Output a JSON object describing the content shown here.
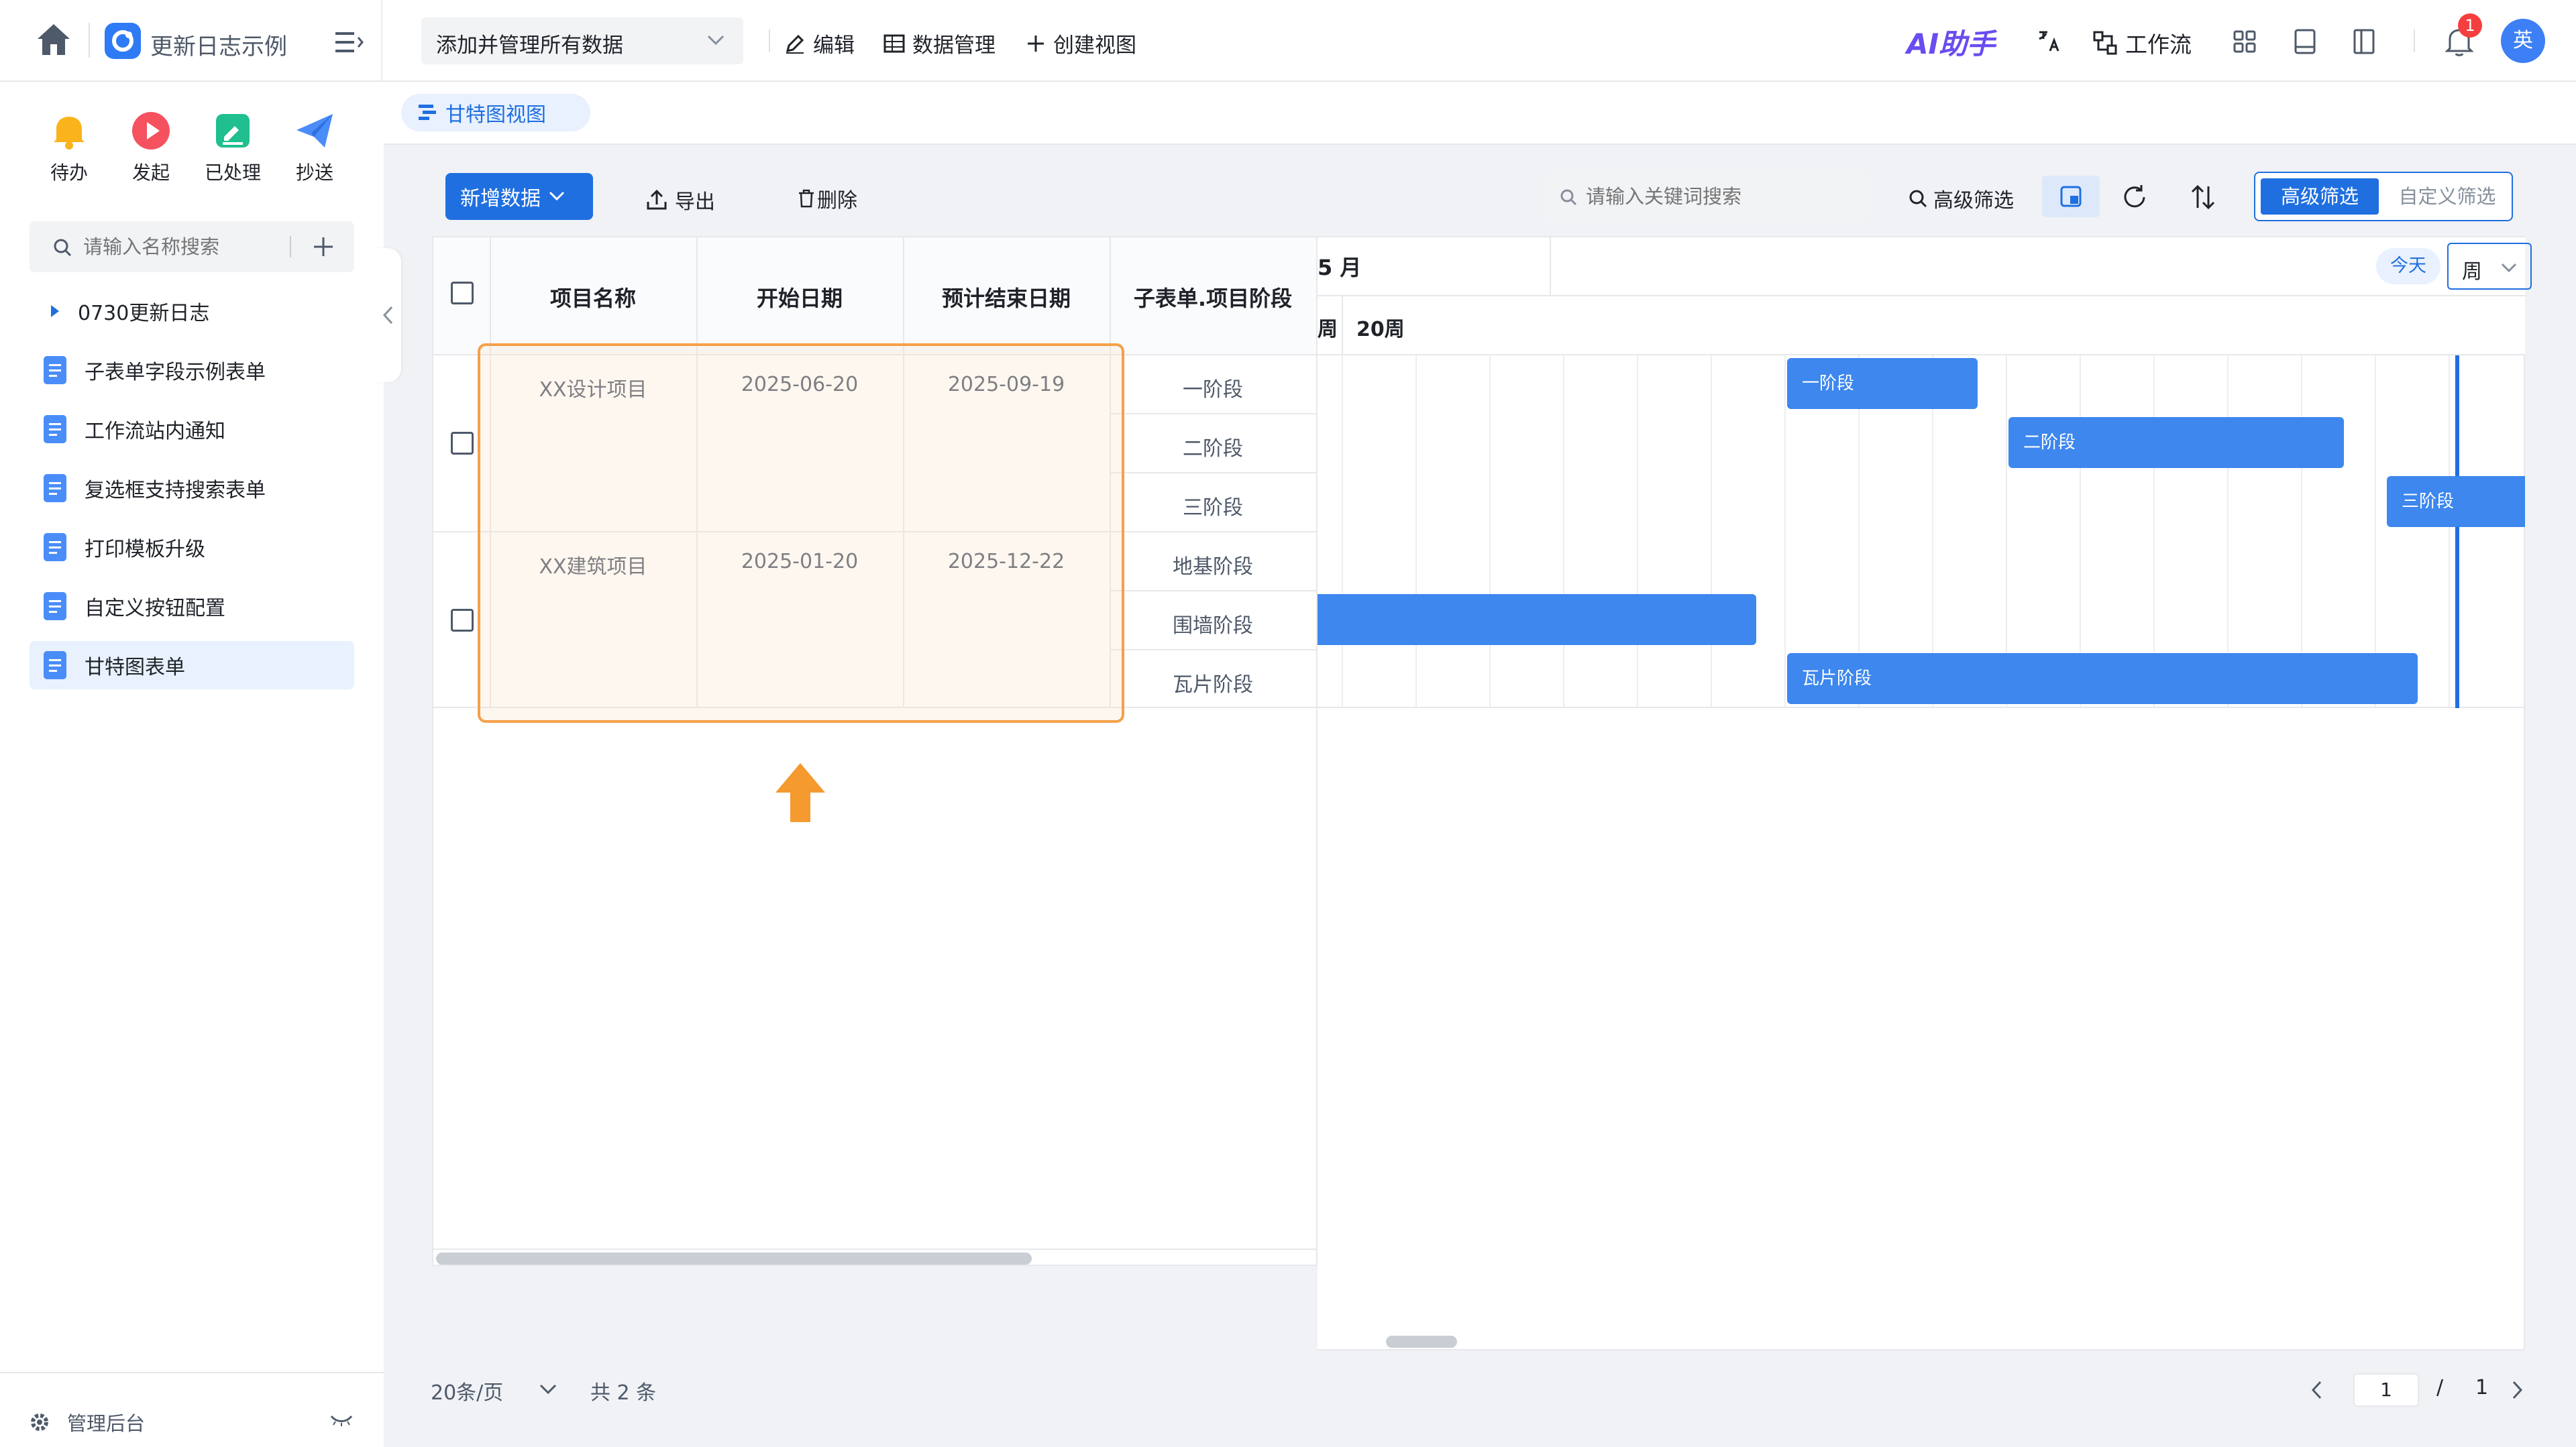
{
  "topbar": {
    "app_name": "更新日志示例",
    "view_select": "添加并管理所有数据",
    "edit": "编辑",
    "data_manage": "数据管理",
    "create_view": "创建视图",
    "ai_assistant": "AI助手",
    "workflow": "工作流",
    "notification_count": "1",
    "avatar": "英"
  },
  "quick": {
    "todo": "待办",
    "initiate": "发起",
    "processed": "已处理",
    "cc": "抄送"
  },
  "sidebar": {
    "search_placeholder": "请输入名称搜索",
    "group": "0730更新日志",
    "items": [
      {
        "label": "子表单字段示例表单"
      },
      {
        "label": "工作流站内通知"
      },
      {
        "label": "复选框支持搜索表单"
      },
      {
        "label": "打印模板升级"
      },
      {
        "label": "自定义按钮配置"
      },
      {
        "label": "甘特图表单"
      }
    ],
    "admin": "管理后台"
  },
  "tab": {
    "label": "甘特图视图"
  },
  "toolbar": {
    "new_data": "新增数据",
    "export": "导出",
    "delete": "删除",
    "search_placeholder": "请输入关键词搜索",
    "advanced_filter": "高级筛选",
    "seg_advanced": "高级筛选",
    "seg_custom": "自定义筛选"
  },
  "table": {
    "headers": [
      "项目名称",
      "开始日期",
      "预计结束日期",
      "子表单.项目阶段"
    ],
    "rows": [
      {
        "name": "XX设计项目",
        "start": "2025-06-20",
        "end": "2025-09-19",
        "stages": [
          "一阶段",
          "二阶段",
          "三阶段"
        ]
      },
      {
        "name": "XX建筑项目",
        "start": "2025-01-20",
        "end": "2025-12-22",
        "stages": [
          "地基阶段",
          "围墙阶段",
          "瓦片阶段"
        ]
      }
    ]
  },
  "gantt": {
    "month": "5 月",
    "week_prev": "周",
    "week": "20周",
    "today": "今天",
    "scale": "周",
    "bars": [
      "一阶段",
      "二阶段",
      "三阶段",
      "",
      "瓦片阶段"
    ]
  },
  "pagination": {
    "page_size": "20条/页",
    "total": "共 2 条",
    "current": "1",
    "sep": "/",
    "pages": "1"
  },
  "colors": {
    "primary": "#1f6fe0",
    "bar": "#3d87ee",
    "highlight_border": "#f5a04a",
    "highlight_fill": "#fdf6ef",
    "arrow": "#f59a2e"
  }
}
